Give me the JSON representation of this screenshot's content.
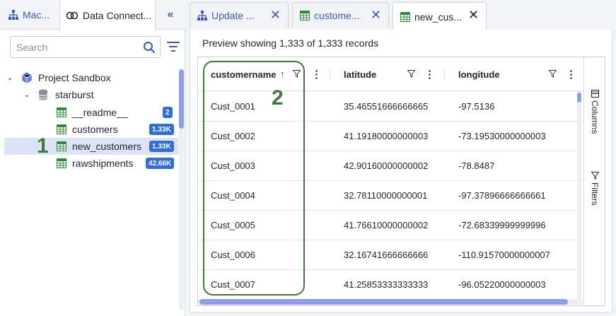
{
  "left_panel": {
    "tabs": [
      {
        "label": "Mac...",
        "icon": "hierarchy-icon"
      },
      {
        "label": "Data Connect...",
        "icon": "data-connection-icon"
      }
    ],
    "collapse_label": "«",
    "search": {
      "placeholder": "Search",
      "value": ""
    },
    "tree": {
      "project": "Project Sandbox",
      "catalog": "starburst",
      "tables": [
        {
          "name": "__readme__",
          "badge": "2"
        },
        {
          "name": "customers",
          "badge": "1.33K"
        },
        {
          "name": "new_customers",
          "badge": "1.33K"
        },
        {
          "name": "rawshipments",
          "badge": "42.66K"
        }
      ]
    }
  },
  "tabs": [
    {
      "label": "Update ...",
      "icon": "hierarchy-icon"
    },
    {
      "label": "custome...",
      "icon": "table-icon"
    },
    {
      "label": "new_cus...",
      "icon": "table-icon"
    }
  ],
  "preview_text": "Preview showing 1,333 of 1,333 records",
  "grid": {
    "columns": [
      "customername",
      "latitude",
      "longitude"
    ],
    "rows": [
      [
        "Cust_0001",
        "35.46551666666665",
        "-97.5136"
      ],
      [
        "Cust_0002",
        "41.19180000000003",
        "-73.19530000000003"
      ],
      [
        "Cust_0003",
        "42.90160000000002",
        "-78.8487"
      ],
      [
        "Cust_0004",
        "32.78110000000001",
        "-97.37896666666661"
      ],
      [
        "Cust_0005",
        "41.76610000000002",
        "-72.68339999999996"
      ],
      [
        "Cust_0006",
        "32.16741666666666",
        "-110.91570000000007"
      ],
      [
        "Cust_0007",
        "41.25853333333333",
        "-96.05220000000003"
      ]
    ],
    "side_tools": [
      "Columns",
      "Filters"
    ]
  },
  "annotations": {
    "marker_1": "1",
    "marker_2": "2"
  },
  "colors": {
    "accent": "#3b5bb5",
    "badge": "#2f6fd6",
    "annotation": "#3f7a3c",
    "selected_row": "#dde3f7",
    "table_icon": "#2e8b3a"
  }
}
